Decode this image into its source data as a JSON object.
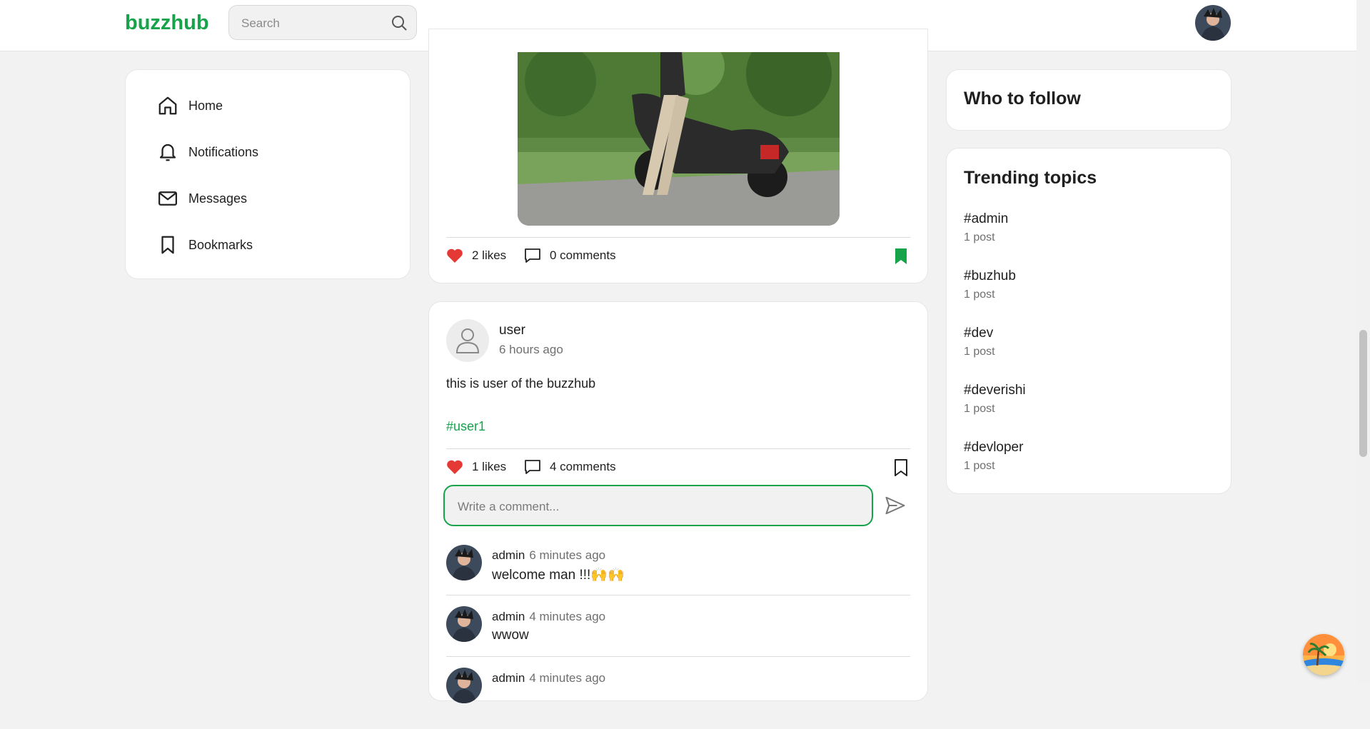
{
  "app": {
    "brand": "buzzhub"
  },
  "search": {
    "placeholder": "Search"
  },
  "sidebar": {
    "items": [
      {
        "label": "Home",
        "icon": "home-icon"
      },
      {
        "label": "Notifications",
        "icon": "bell-icon"
      },
      {
        "label": "Messages",
        "icon": "mail-icon"
      },
      {
        "label": "Bookmarks",
        "icon": "bookmark-icon"
      }
    ]
  },
  "post1": {
    "likes": "2 likes",
    "comments": "0 comments",
    "bookmarked": true
  },
  "post2": {
    "user": "user",
    "time": "6 hours ago",
    "text": "this is user of the buzzhub",
    "hashtag": "#user1",
    "likes": "1 likes",
    "comments": "4 comments",
    "bookmarked": false,
    "comment_placeholder": "Write a comment..."
  },
  "comments": [
    {
      "user": "admin",
      "time": "6 minutes ago",
      "text": "welcome man !!!🙌🙌"
    },
    {
      "user": "admin",
      "time": "4 minutes ago",
      "text": "wwow"
    },
    {
      "user": "admin",
      "time": "4 minutes ago",
      "text": ""
    }
  ],
  "who_to_follow": {
    "title": "Who to follow"
  },
  "trending": {
    "title": "Trending topics",
    "topics": [
      {
        "tag": "#admin",
        "count": "1 post"
      },
      {
        "tag": "#buzhub",
        "count": "1 post"
      },
      {
        "tag": "#dev",
        "count": "1 post"
      },
      {
        "tag": "#deverishi",
        "count": "1 post"
      },
      {
        "tag": "#devloper",
        "count": "1 post"
      }
    ]
  },
  "colors": {
    "accent": "#16a34a",
    "like": "#e53935",
    "background": "#f2f2f2"
  }
}
